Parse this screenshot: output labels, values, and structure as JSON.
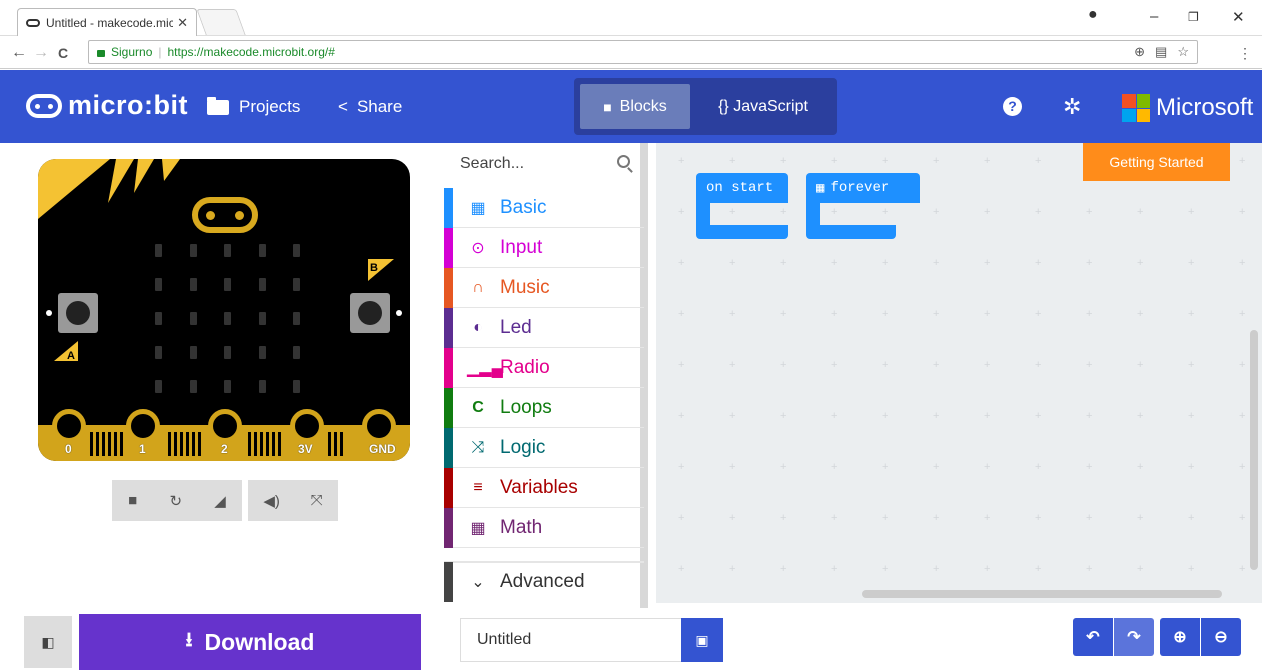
{
  "browser": {
    "tab_title": "Untitled - makecode.mic",
    "tab_close": "✕",
    "secure_label": "Sigurno",
    "url": "https://makecode.microbit.org/#",
    "back": "←",
    "forward": "→",
    "reload": "C",
    "window_controls": [
      "–",
      "❐",
      "✕"
    ]
  },
  "header": {
    "logo_text": "micro:bit",
    "projects_label": "Projects",
    "share_label": "Share",
    "blocks_label": "Blocks",
    "javascript_label": "{} JavaScript",
    "help_icon": "?",
    "microsoft_label": "Microsoft",
    "microsoft_colors": [
      "#f25022",
      "#7fba00",
      "#00a4ef",
      "#ffb900"
    ],
    "accent_color": "#3454d1"
  },
  "simulator": {
    "button_a": "A",
    "button_b": "B",
    "pins": [
      "0",
      "1",
      "2",
      "3V",
      "GND"
    ]
  },
  "toolbox": {
    "search_placeholder": "Search...",
    "categories": [
      {
        "label": "Basic",
        "color": "#1e90ff",
        "icon": "grid-icon"
      },
      {
        "label": "Input",
        "color": "#d400d4",
        "icon": "target-icon"
      },
      {
        "label": "Music",
        "color": "#e65722",
        "icon": "headphones-icon"
      },
      {
        "label": "Led",
        "color": "#5c2d91",
        "icon": "toggle-icon"
      },
      {
        "label": "Radio",
        "color": "#e3008c",
        "icon": "signal-icon"
      },
      {
        "label": "Loops",
        "color": "#107c10",
        "icon": "loop-icon"
      },
      {
        "label": "Logic",
        "color": "#006970",
        "icon": "shuffle-icon"
      },
      {
        "label": "Variables",
        "color": "#a80000",
        "icon": "lines-icon"
      },
      {
        "label": "Math",
        "color": "#712672",
        "icon": "calculator-icon"
      }
    ],
    "advanced_label": "Advanced"
  },
  "workspace": {
    "blocks": [
      "on start",
      "forever"
    ],
    "getting_started": "Getting Started"
  },
  "bottom": {
    "download_label": "Download",
    "project_name": "Untitled"
  }
}
